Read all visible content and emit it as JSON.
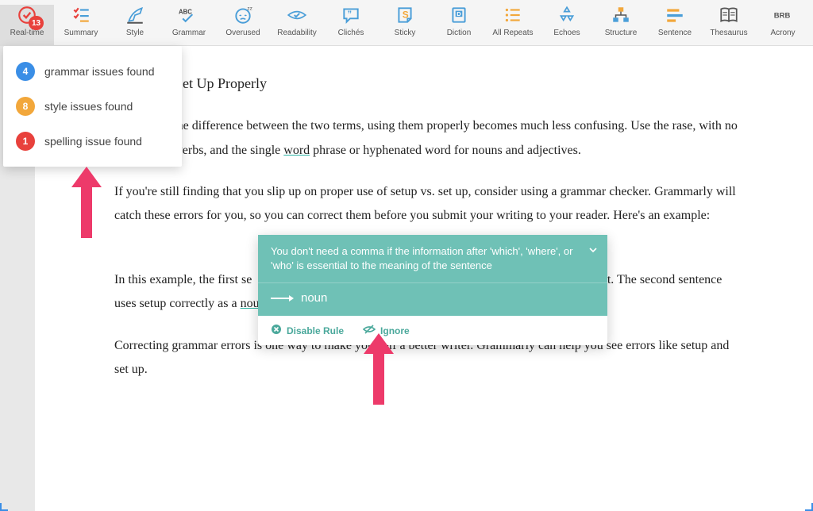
{
  "toolbar": {
    "realtime_badge": "13",
    "items": [
      {
        "label": "Real-time"
      },
      {
        "label": "Summary"
      },
      {
        "label": "Style"
      },
      {
        "label": "Grammar"
      },
      {
        "label": "Overused"
      },
      {
        "label": "Readability"
      },
      {
        "label": "Clichés"
      },
      {
        "label": "Sticky"
      },
      {
        "label": "Diction"
      },
      {
        "label": "All Repeats"
      },
      {
        "label": "Echoes"
      },
      {
        "label": "Structure"
      },
      {
        "label": "Sentence"
      },
      {
        "label": "Thesaurus"
      },
      {
        "label": "Acrony"
      }
    ]
  },
  "dropdown": {
    "items": [
      {
        "count": "4",
        "label": "grammar issues found"
      },
      {
        "count": "8",
        "label": "style issues found"
      },
      {
        "count": "1",
        "label": "spelling issue found"
      }
    ]
  },
  "doc": {
    "heading": "Setup and Set Up Properly",
    "p1a": "understand the difference between the two terms, using them properly becomes much less confusing. Use the",
    "p1b": "rase, with no hyphen, for verbs, and the single ",
    "p1_word": "word",
    "p1c": " phrase or hyphenated word for nouns and adjectives.",
    "p2": "If you're still finding that you slip up on proper use of setup vs. set up, consider using a grammar checker. Grammarly will catch these errors for you, so you can correct them before you submit your writing to your reader. Here's an example:",
    "p3a": "In this example, the first se",
    "p3b": "rect. The second sentence uses setup correctly as a ",
    "p3_noun": "noun,",
    "p3c": " v",
    "p4": "Correcting grammar errors is one way to make yourself a better writer. Grammarly can help you see errors like setup and set up."
  },
  "tooltip": {
    "message": "You don't need a comma if the information after 'which', 'where', or 'who' is essential to the meaning of the sentence",
    "suggestion": "noun",
    "disable": "Disable Rule",
    "ignore": "Ignore"
  }
}
